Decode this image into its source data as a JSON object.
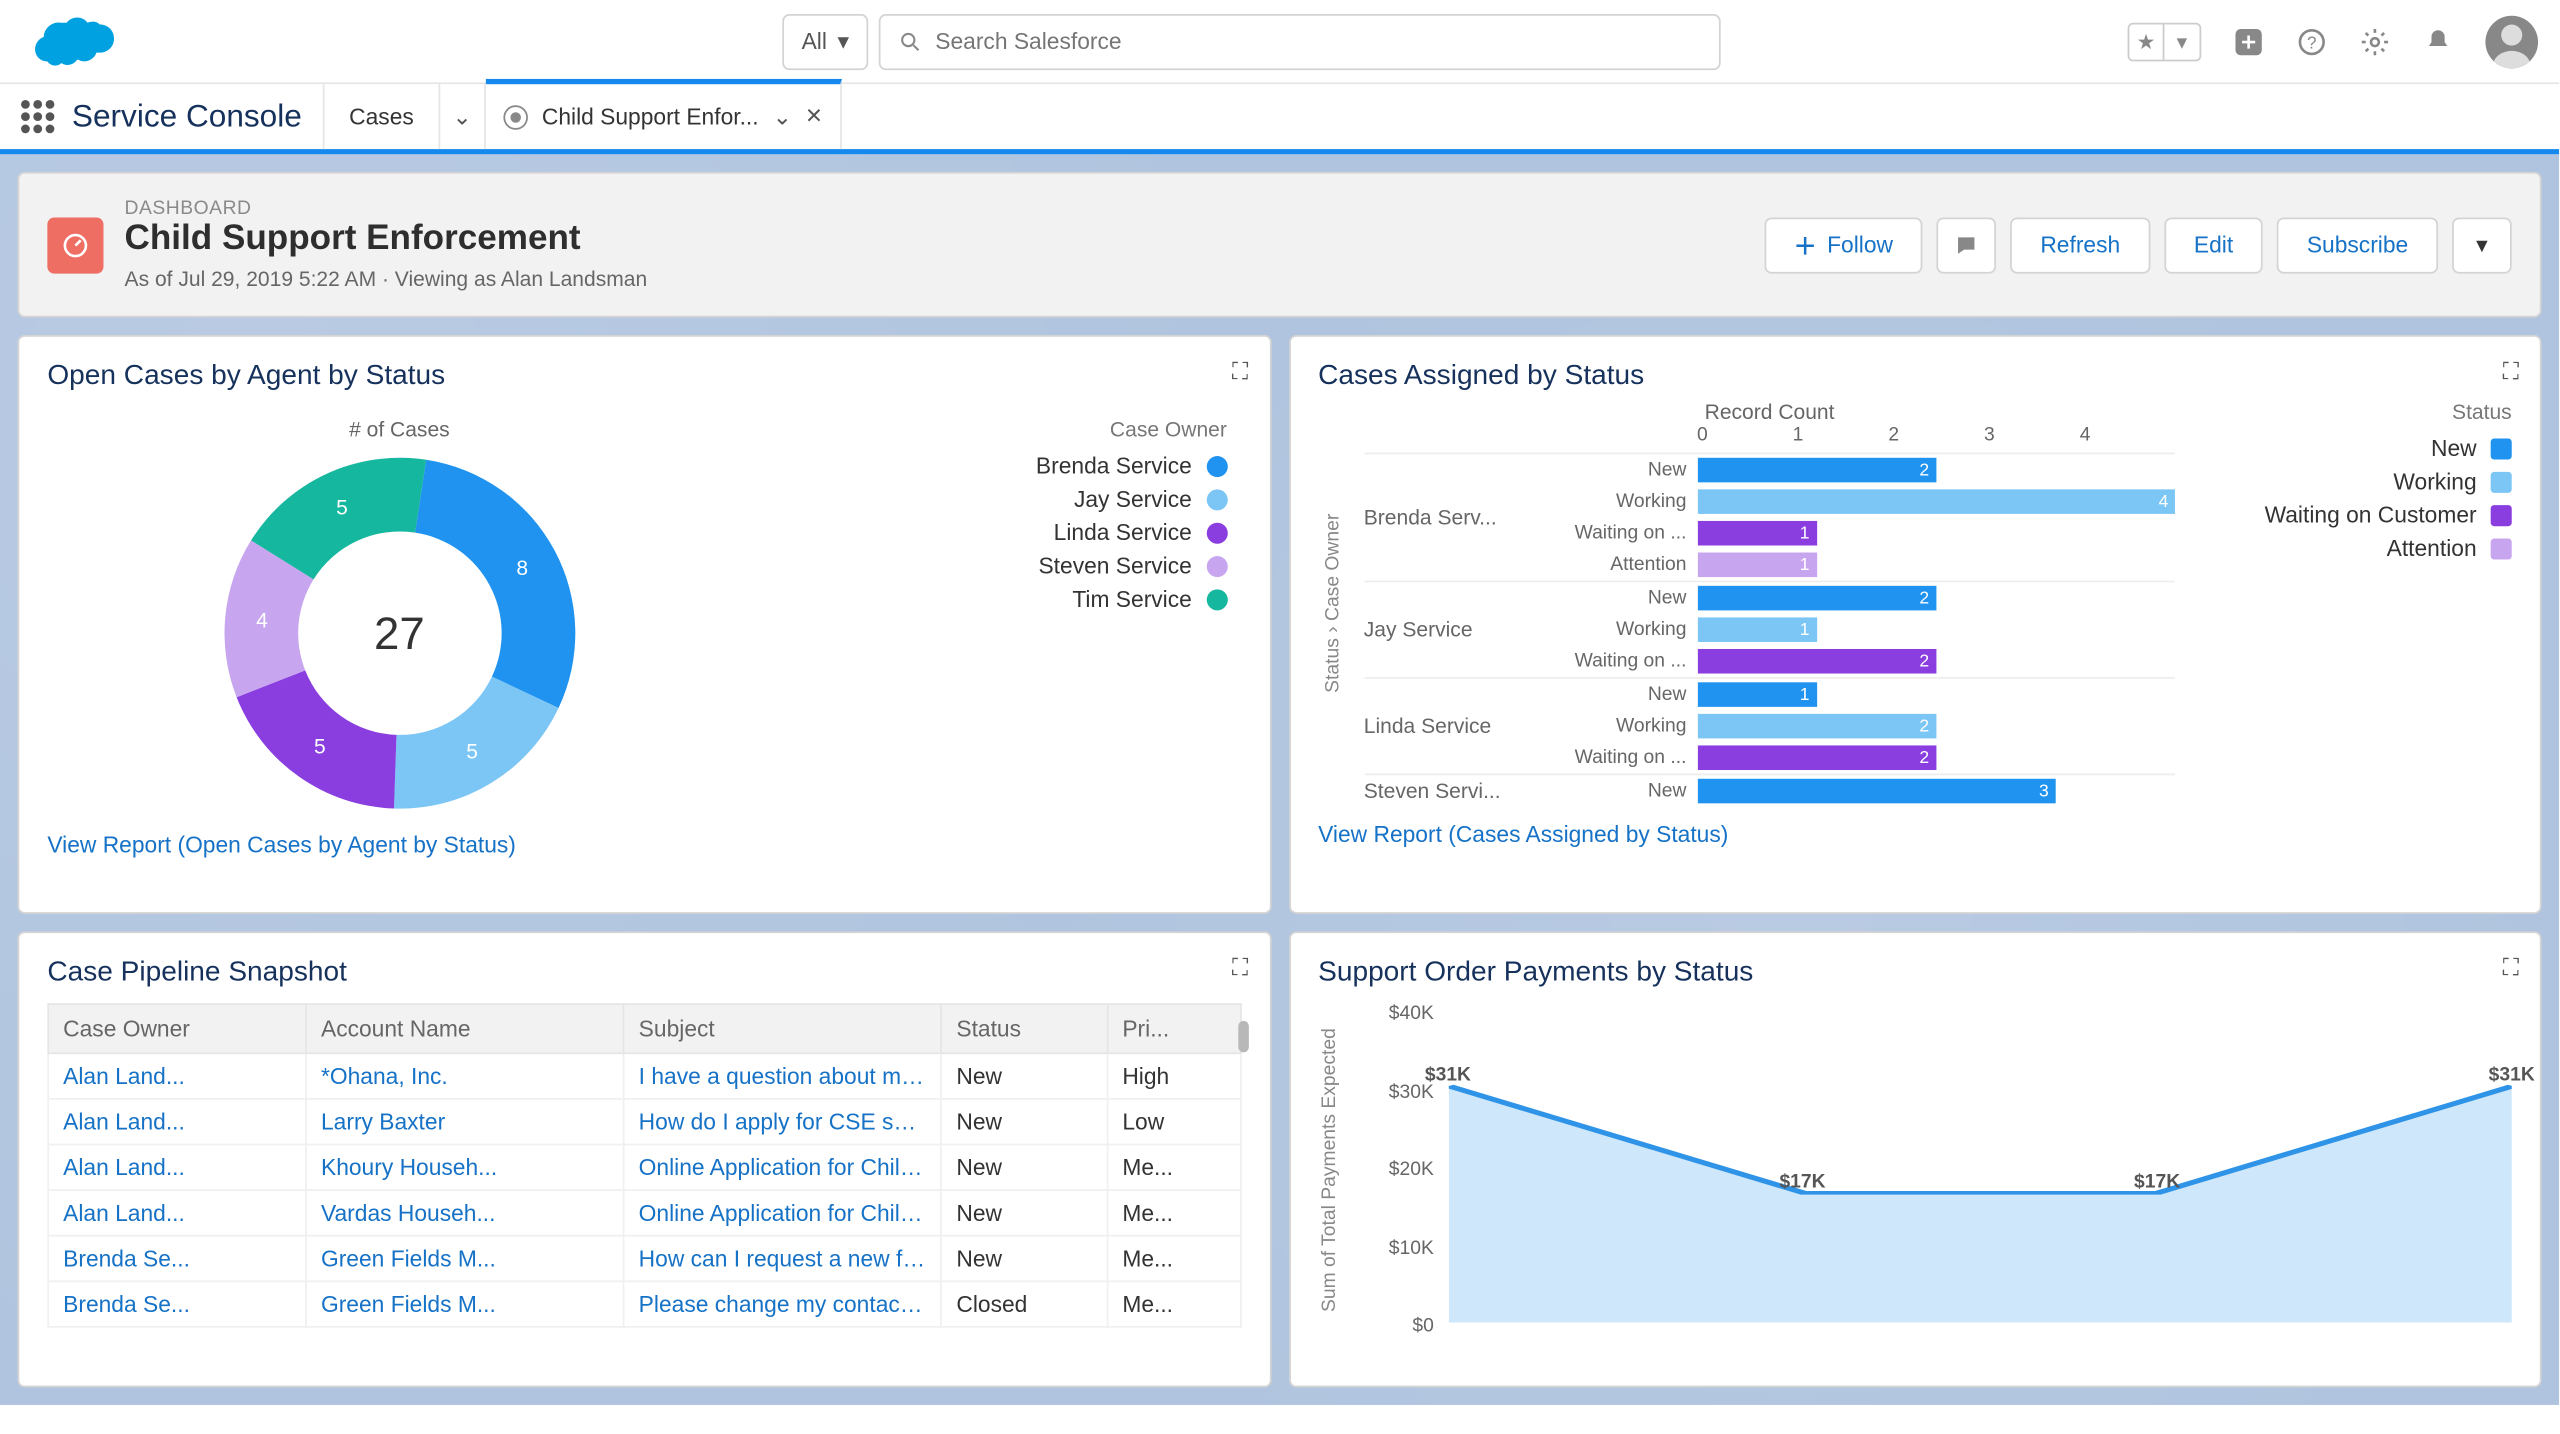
{
  "search": {
    "scope": "All",
    "placeholder": "Search Salesforce"
  },
  "app": {
    "name": "Service Console"
  },
  "nav": {
    "object": "Cases",
    "tab": "Child Support Enfor..."
  },
  "dashboard": {
    "kicker": "DASHBOARD",
    "title": "Child Support Enforcement",
    "asof": "As of Jul 29, 2019 5:22 AM · Viewing as Alan Landsman",
    "actions": {
      "follow": "Follow",
      "refresh": "Refresh",
      "edit": "Edit",
      "subscribe": "Subscribe"
    }
  },
  "card1": {
    "title": "Open Cases by Agent by Status",
    "subtitle": "# of Cases",
    "legend_header": "Case Owner",
    "total": "27",
    "report_link": "View Report (Open Cases by Agent by Status)",
    "segments": [
      {
        "label": "Brenda Service",
        "value": 8,
        "color": "#1f93ef"
      },
      {
        "label": "Jay Service",
        "value": 5,
        "color": "#7cc6f6"
      },
      {
        "label": "Linda Service",
        "value": 5,
        "color": "#8a3ee0"
      },
      {
        "label": "Steven Service",
        "value": 4,
        "color": "#c8a6ef"
      },
      {
        "label": "Tim Service",
        "value": 5,
        "color": "#15b79e"
      }
    ]
  },
  "card2": {
    "title": "Cases Assigned by Status",
    "axis_title": "Record Count",
    "ylabel": "Status  ›  Case Owner",
    "legend_header": "Status",
    "report_link": "View Report (Cases Assigned by Status)",
    "x_ticks": [
      "0",
      "1",
      "2",
      "3",
      "4"
    ],
    "x_max": 4,
    "status_colors": {
      "New": "#1f93ef",
      "Working": "#7cc6f6",
      "Waiting on Customer": "#8a3ee0",
      "Attention": "#c8a6ef"
    },
    "status_legend": [
      "New",
      "Working",
      "Waiting on Customer",
      "Attention"
    ],
    "groups": [
      {
        "owner": "Brenda Serv...",
        "rows": [
          {
            "status": "New",
            "value": 2
          },
          {
            "status": "Working",
            "value": 4
          },
          {
            "status": "Waiting on ...",
            "value": 1
          },
          {
            "status": "Attention",
            "value": 1
          }
        ]
      },
      {
        "owner": "Jay Service",
        "rows": [
          {
            "status": "New",
            "value": 2
          },
          {
            "status": "Working",
            "value": 1
          },
          {
            "status": "Waiting on ...",
            "value": 2
          }
        ]
      },
      {
        "owner": "Linda Service",
        "rows": [
          {
            "status": "New",
            "value": 1
          },
          {
            "status": "Working",
            "value": 2
          },
          {
            "status": "Waiting on ...",
            "value": 2
          }
        ]
      },
      {
        "owner": "Steven Servi...",
        "rows": [
          {
            "status": "New",
            "value": 3
          }
        ]
      }
    ]
  },
  "card3": {
    "title": "Case Pipeline Snapshot",
    "columns": [
      "Case Owner",
      "Account Name",
      "Subject",
      "Status",
      "Pri..."
    ],
    "rows": [
      [
        "Alan Land...",
        "*Ohana, Inc.",
        "I have a question about my court date",
        "New",
        "High"
      ],
      [
        "Alan Land...",
        "Larry Baxter",
        "How do I apply for CSE services?",
        "New",
        "Low"
      ],
      [
        "Alan Land...",
        "Khoury Househ...",
        "Online Application for Child Support Services",
        "New",
        "Me..."
      ],
      [
        "Alan Land...",
        "Vardas Househ...",
        "Online Application for Child Support Services",
        "New",
        "Me..."
      ],
      [
        "Brenda Se...",
        "Green Fields M...",
        "How can I request a new feature?",
        "New",
        "Me..."
      ],
      [
        "Brenda Se...",
        "Green Fields M...",
        "Please change my contact information.",
        "Closed",
        "Me..."
      ]
    ]
  },
  "card4": {
    "title": "Support Order Payments by Status",
    "ylabel": "Sum of Total Payments Expected",
    "y_ticks": [
      "$40K",
      "$30K",
      "$20K",
      "$10K",
      "$0"
    ],
    "y_max": 40,
    "points": [
      {
        "label": "$31K",
        "y": 31
      },
      {
        "label": "$17K",
        "y": 17
      },
      {
        "label": "$17K",
        "y": 17
      },
      {
        "label": "$31K",
        "y": 31
      }
    ]
  },
  "chart_data": [
    {
      "type": "pie",
      "title": "Open Cases by Agent by Status",
      "center_total": 27,
      "series": [
        {
          "name": "# of Cases",
          "categories": [
            "Brenda Service",
            "Jay Service",
            "Linda Service",
            "Steven Service",
            "Tim Service"
          ],
          "values": [
            8,
            5,
            5,
            4,
            5
          ]
        }
      ]
    },
    {
      "type": "bar",
      "title": "Cases Assigned by Status",
      "xlabel": "Record Count",
      "xlim": [
        0,
        4
      ],
      "categories": [
        "Brenda Service / New",
        "Brenda Service / Working",
        "Brenda Service / Waiting on Customer",
        "Brenda Service / Attention",
        "Jay Service / New",
        "Jay Service / Working",
        "Jay Service / Waiting on Customer",
        "Linda Service / New",
        "Linda Service / Working",
        "Linda Service / Waiting on Customer",
        "Steven Service / New"
      ],
      "values": [
        2,
        4,
        1,
        1,
        2,
        1,
        2,
        1,
        2,
        2,
        3
      ]
    },
    {
      "type": "table",
      "title": "Case Pipeline Snapshot",
      "columns": [
        "Case Owner",
        "Account Name",
        "Subject",
        "Status",
        "Priority"
      ],
      "rows": [
        [
          "Alan Landsman",
          "*Ohana, Inc.",
          "I have a question about my court date",
          "New",
          "High"
        ],
        [
          "Alan Landsman",
          "Larry Baxter",
          "How do I apply for CSE services?",
          "New",
          "Low"
        ],
        [
          "Alan Landsman",
          "Khoury Household",
          "Online Application for Child Support Services",
          "New",
          "Medium"
        ],
        [
          "Alan Landsman",
          "Vardas Household",
          "Online Application for Child Support Services",
          "New",
          "Medium"
        ],
        [
          "Brenda Service",
          "Green Fields M...",
          "How can I request a new feature?",
          "New",
          "Medium"
        ],
        [
          "Brenda Service",
          "Green Fields M...",
          "Please change my contact information.",
          "Closed",
          "Medium"
        ]
      ]
    },
    {
      "type": "area",
      "title": "Support Order Payments by Status",
      "ylabel": "Sum of Total Payments Expected",
      "ylim": [
        0,
        40000
      ],
      "x": [
        0,
        1,
        2,
        3
      ],
      "values": [
        31000,
        17000,
        17000,
        31000
      ]
    }
  ]
}
